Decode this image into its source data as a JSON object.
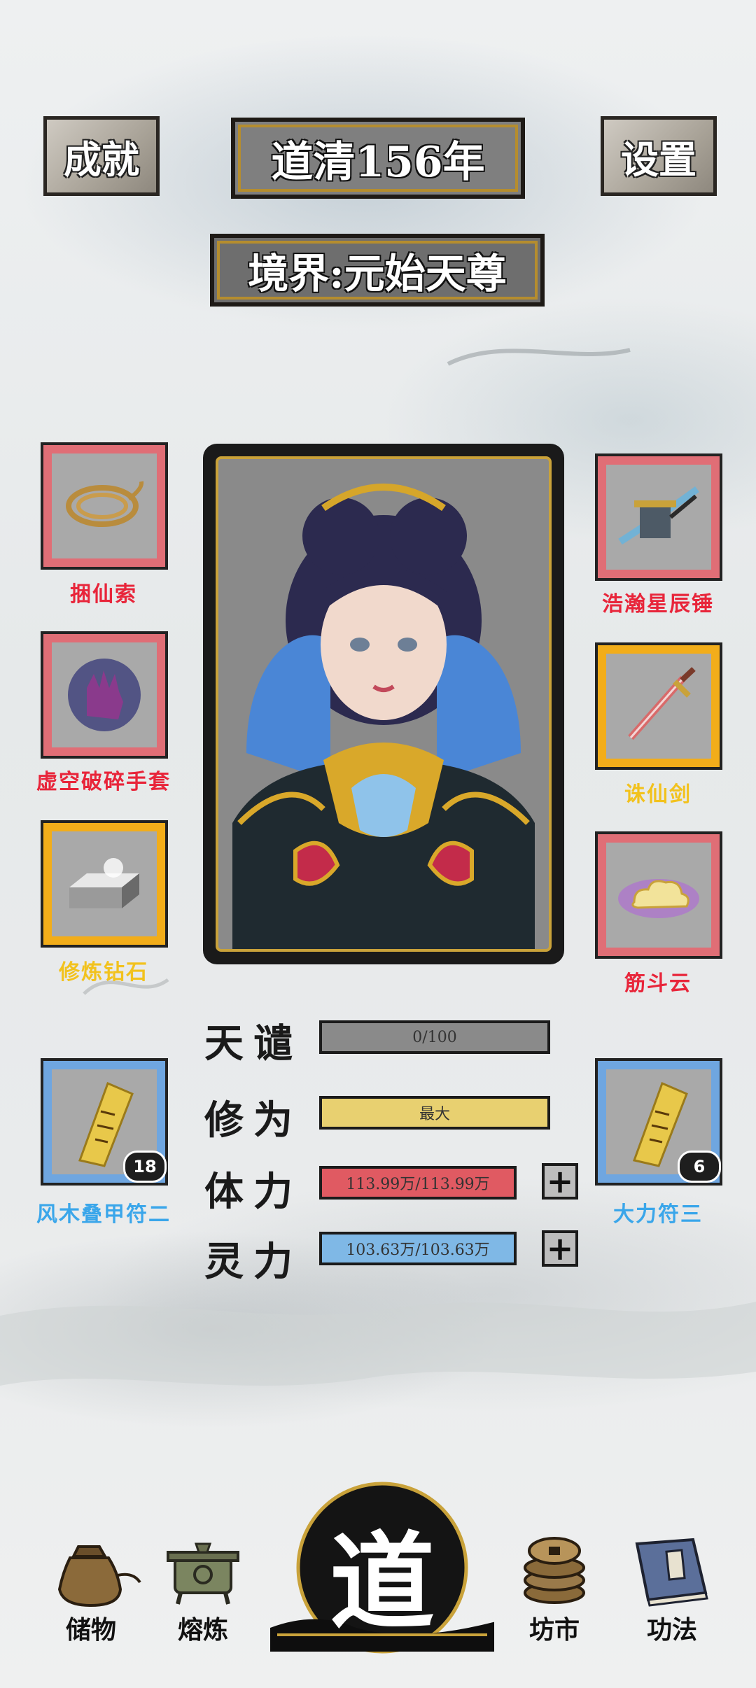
{
  "header": {
    "achievement_label": "成就",
    "year_label": "道清156年",
    "settings_label": "设置",
    "realm_label": "境界:元始天尊"
  },
  "equipment": {
    "left": [
      {
        "name": "捆仙索",
        "tier": "red"
      },
      {
        "name": "虚空破碎手套",
        "tier": "red"
      },
      {
        "name": "修炼钻石",
        "tier": "gold"
      }
    ],
    "right": [
      {
        "name": "浩瀚星辰锤",
        "tier": "red"
      },
      {
        "name": "诛仙剑",
        "tier": "gold"
      },
      {
        "name": "筋斗云",
        "tier": "red"
      }
    ]
  },
  "talismans": [
    {
      "name": "风木叠甲符二",
      "count": "18"
    },
    {
      "name": "大力符三",
      "count": "6"
    }
  ],
  "stats": {
    "tianqian": {
      "label": "天谴",
      "value": "0/100",
      "fill": 0.0
    },
    "xiuwei": {
      "label": "修为",
      "value": "最大",
      "fill": 1.0
    },
    "tili": {
      "label": "体力",
      "value": "113.99万/113.99万",
      "fill": 1.0
    },
    "lingli": {
      "label": "灵力",
      "value": "103.63万/103.63万",
      "fill": 1.0
    }
  },
  "nav": {
    "storage": "储物",
    "smelting": "熔炼",
    "center": "道",
    "market": "坊市",
    "skills": "功法"
  },
  "colors": {
    "red_tier": "#e06e76",
    "gold_tier": "#f2ad1a",
    "blue_tier": "#6fa6e0",
    "hp_bar": "#e05a62",
    "mp_bar": "#7fb8e6",
    "cultivation_bar": "#e8d070"
  }
}
